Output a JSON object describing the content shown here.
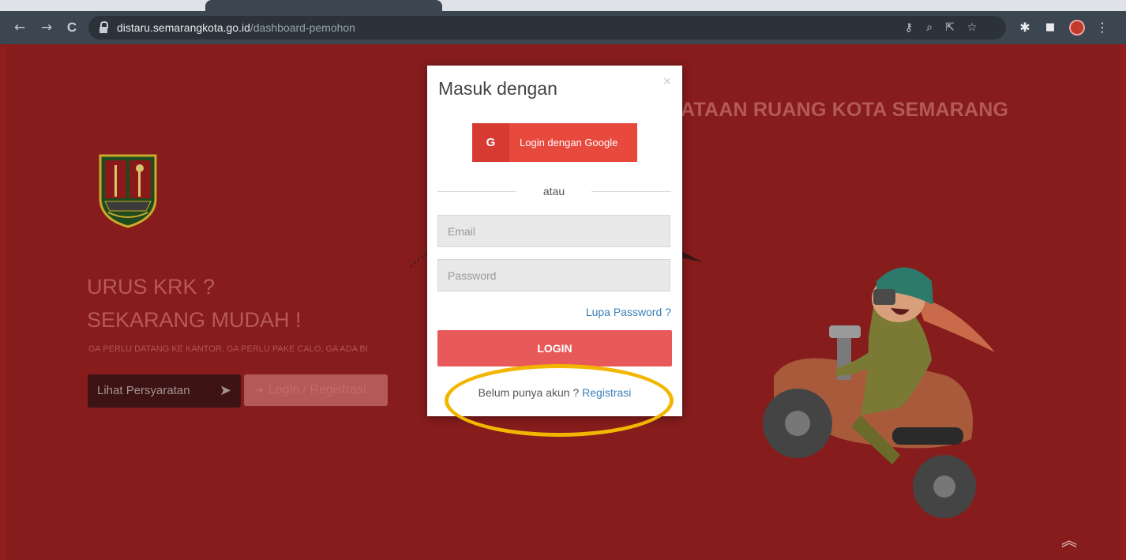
{
  "browser": {
    "url_host": "distaru.semarangkota.go.id",
    "url_path": "/dashboard-pemohon",
    "icons": [
      "back-arrow-icon",
      "forward-arrow-icon",
      "reload-icon",
      "lock-icon",
      "key-icon",
      "zoom-icon",
      "share-icon",
      "star-icon",
      "extensions-icon",
      "sidepanel-icon",
      "profile-avatar",
      "menu-dots-icon"
    ],
    "glyphs": {
      "back": "←",
      "forward": "→",
      "reload": "C",
      "key": "⚷",
      "zoom": "⌕",
      "share": "⇱",
      "star": "☆",
      "puzzle": "✱",
      "panel": "■",
      "menu": "⋮"
    }
  },
  "page": {
    "site_title": "ATAAN RUANG KOTA SEMARANG",
    "headline_line1": "URUS KRK ?",
    "headline_line2": "SEKARANG MUDAH !",
    "tagline": "GA PERLU DATANG KE KANTOR, GA PERLU PAKE CALO, GA ADA BI",
    "btn_requirements": "Lihat Persyaratan",
    "btn_login_register": "Login / Registrasi",
    "scroll_top": "︽"
  },
  "modal": {
    "title": "Masuk dengan",
    "close": "×",
    "google_letter": "G",
    "google_label": "Login dengan Google",
    "divider": "atau",
    "email_placeholder": "Email",
    "password_placeholder": "Password",
    "forgot": "Lupa Password ?",
    "submit": "LOGIN",
    "no_account": "Belum punya akun ?",
    "register_link": "Registrasi"
  },
  "colors": {
    "page_bg": "#861c1c",
    "google_red": "#e8493d",
    "login_red": "#e8595a",
    "link_blue": "#3a7fb7",
    "highlight": "#f2b600"
  }
}
